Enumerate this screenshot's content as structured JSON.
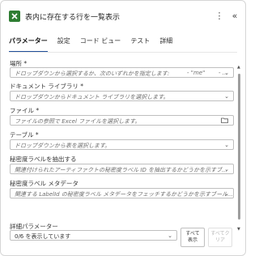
{
  "header": {
    "title": "表内に存在する行を一覧表示",
    "more_icon": "more-vertical-icon",
    "collapse_icon": "collapse-double-chevron-icon",
    "accent_color": "#2e7d32"
  },
  "tabs": [
    {
      "label": "パラメーター",
      "active": true
    },
    {
      "label": "設定"
    },
    {
      "label": "コード ビュー"
    },
    {
      "label": "テスト"
    },
    {
      "label": "詳細"
    }
  ],
  "fields": {
    "location": {
      "label": "場所 *",
      "placeholder": "ドロップダウンから選択するか、次のいずれかを指定します:",
      "value_hint": "- \"me\"",
      "value_hint2": "- ..."
    },
    "document_library": {
      "label": "ドキュメント ライブラリ *",
      "placeholder": "ドロップダウンからドキュメント ライブラリを選択します。"
    },
    "file": {
      "label": "ファイル *",
      "placeholder": "ファイルの参照で Excel ファイルを選択します。"
    },
    "table": {
      "label": "テーブル *",
      "placeholder": "ドロップダウンから表を選択します。"
    },
    "extract_sensitivity": {
      "label": "秘密度ラベルを抽出する",
      "placeholder": "関連付けられたアーティファクトの秘密度ラベル ID を抽出するかどうかを示すブ..."
    },
    "sensitivity_metadata": {
      "label": "秘密度ラベル メタデータ",
      "placeholder": "関連する LabelId の秘密度ラベル メタデータをフェッチするかどうかを示すブール..."
    }
  },
  "advanced": {
    "label": "詳細パラメーター",
    "select_value": "0/6 を表示しています",
    "show_all_line1": "すべて",
    "show_all_line2": "表示",
    "clear_all_line1": "すべてク",
    "clear_all_line2": "リア"
  }
}
